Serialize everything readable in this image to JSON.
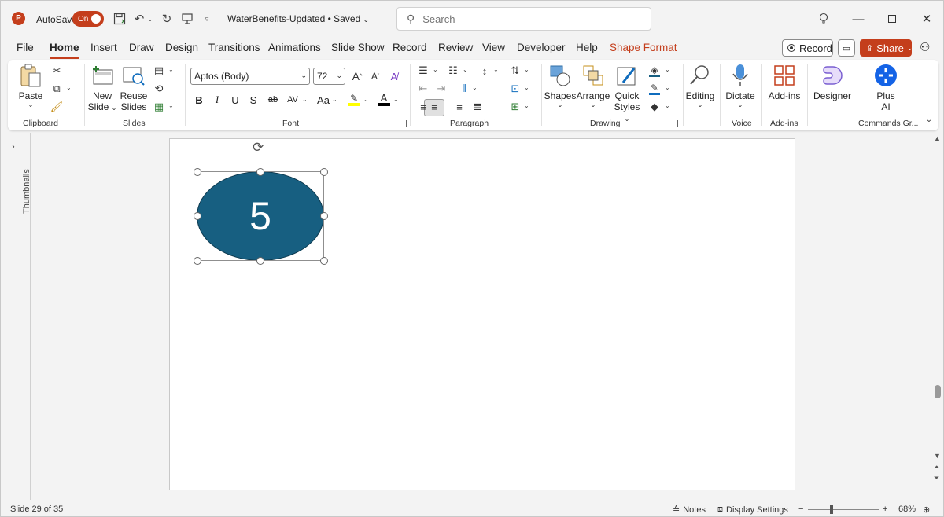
{
  "titlebar": {
    "app_icon": "P",
    "autosave_label": "AutoSave",
    "autosave_state": "On",
    "doc_title": "WaterBenefits-Updated • Saved",
    "search_placeholder": "Search"
  },
  "menu": {
    "tabs": [
      "File",
      "Home",
      "Insert",
      "Draw",
      "Design",
      "Transitions",
      "Animations",
      "Slide Show",
      "Record",
      "Review",
      "View",
      "Developer",
      "Help",
      "Shape Format"
    ],
    "active_tab": "Home",
    "record_label": "Record",
    "share_label": "Share"
  },
  "ribbon": {
    "clipboard": {
      "paste": "Paste",
      "label": "Clipboard"
    },
    "slides": {
      "new_slide_1": "New",
      "new_slide_2": "Slide",
      "reuse_1": "Reuse",
      "reuse_2": "Slides",
      "label": "Slides"
    },
    "font": {
      "font_name": "Aptos (Body)",
      "font_size": "72",
      "label": "Font",
      "bold": "B",
      "italic": "I",
      "underline": "U",
      "shadow": "S",
      "strike": "ab",
      "spacing": "AV",
      "case": "Aa"
    },
    "paragraph": {
      "label": "Paragraph"
    },
    "drawing": {
      "shapes": "Shapes",
      "arrange": "Arrange",
      "quick_1": "Quick",
      "quick_2": "Styles",
      "label": "Drawing"
    },
    "editing": {
      "label": "Editing"
    },
    "voice": {
      "dictate": "Dictate",
      "label": "Voice"
    },
    "addins": {
      "btn": "Add-ins",
      "label": "Add-ins"
    },
    "designer": {
      "btn": "Designer"
    },
    "plusai": {
      "btn_1": "Plus",
      "btn_2": "AI",
      "label": "Commands Gr..."
    }
  },
  "sidebar": {
    "thumbnails_label": "Thumbnails"
  },
  "slide": {
    "shape_text": "5",
    "shape_fill": "#175f81"
  },
  "status": {
    "slide_info": "Slide 29 of 35",
    "notes": "Notes",
    "display_settings": "Display Settings",
    "zoom": "68%"
  },
  "colors": {
    "accent": "#c43e1c",
    "shape": "#175f81"
  }
}
